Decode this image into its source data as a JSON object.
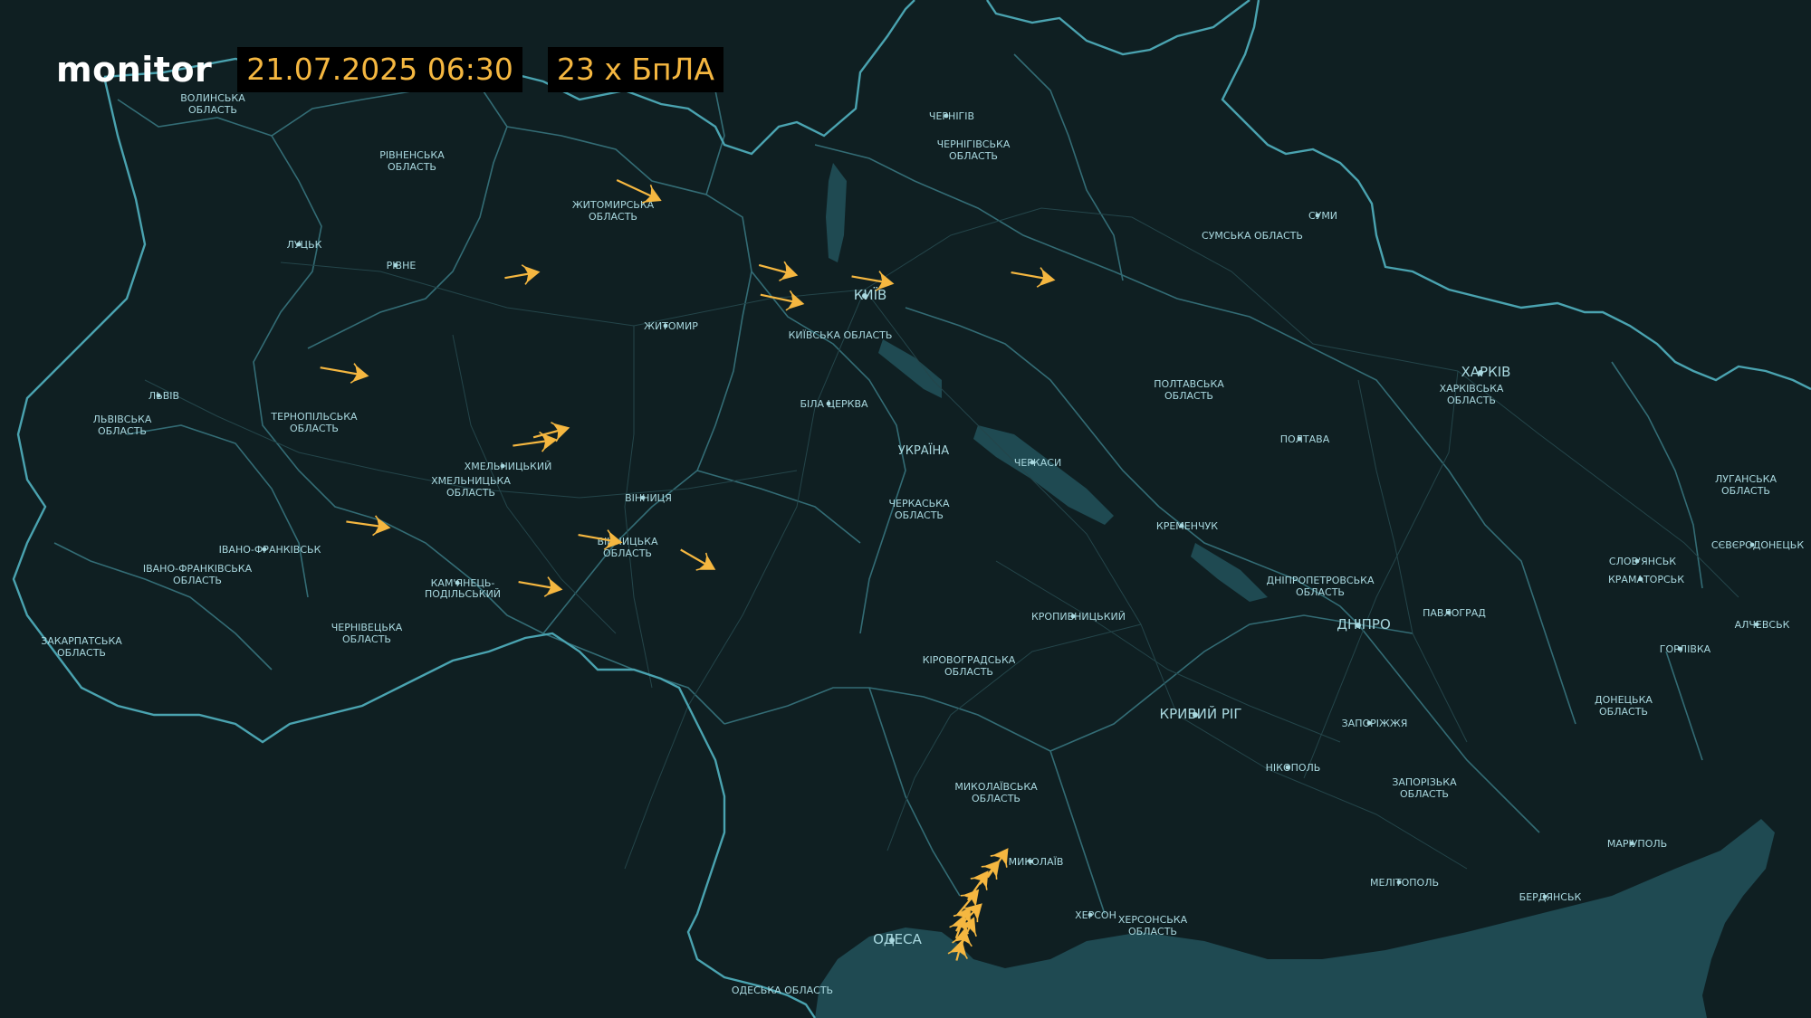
{
  "header": {
    "logo": "monitor",
    "datetime": "21.07.2025 06:30",
    "count": "23 х БпЛА"
  },
  "colors": {
    "background": "#0f1f22",
    "border": "#4aa3b0",
    "water": "#1f4a52",
    "label": "#a9d8df",
    "drone": "#f5b740"
  },
  "cities": [
    {
      "id": "kyiv",
      "name": "КИЇВ",
      "size": "lg"
    },
    {
      "id": "chernihiv",
      "name": "ЧЕРНІГІВ",
      "size": "sm"
    },
    {
      "id": "sumy",
      "name": "СУМИ",
      "size": "sm"
    },
    {
      "id": "kharkiv",
      "name": "ХАРКІВ",
      "size": "lg"
    },
    {
      "id": "zhytomyr",
      "name": "ЖИТОМИР",
      "size": "sm"
    },
    {
      "id": "lutsk",
      "name": "ЛУЦЬК",
      "size": "sm"
    },
    {
      "id": "rivne",
      "name": "РІВНЕ",
      "size": "sm"
    },
    {
      "id": "lviv",
      "name": "ЛЬВІВ",
      "size": "sm"
    },
    {
      "id": "khmelnytskyi",
      "name": "ХМЕЛЬНИЦЬКИЙ",
      "size": "sm"
    },
    {
      "id": "vinnytsia",
      "name": "ВІННИЦЯ",
      "size": "sm"
    },
    {
      "id": "bilatserkva",
      "name": "БІЛА ЦЕРКВА",
      "size": "sm"
    },
    {
      "id": "cherkasy",
      "name": "ЧЕРКАСИ",
      "size": "sm"
    },
    {
      "id": "poltava",
      "name": "ПОЛТАВА",
      "size": "sm"
    },
    {
      "id": "kremenchuk",
      "name": "КРЕМЕНЧУК",
      "size": "sm"
    },
    {
      "id": "ivanofrankivsk",
      "name": "ІВАНО-ФРАНКІВСЬК",
      "size": "sm"
    },
    {
      "id": "kamianets",
      "name": "КАМ'ЯНЕЦЬ-\nПОДІЛЬСЬКИЙ",
      "size": "sm"
    },
    {
      "id": "kropyvnytskyi",
      "name": "КРОПИВНИЦЬКИЙ",
      "size": "sm"
    },
    {
      "id": "dnipro",
      "name": "ДНІПРО",
      "size": "lg"
    },
    {
      "id": "pavlohrad",
      "name": "ПАВЛОГРАД",
      "size": "sm"
    },
    {
      "id": "kryvyirih",
      "name": "КРИВИЙ РІГ",
      "size": "lg"
    },
    {
      "id": "zaporizhzhia",
      "name": "ЗАПОРІЖЖЯ",
      "size": "sm"
    },
    {
      "id": "nikopol",
      "name": "НІКОПОЛЬ",
      "size": "sm"
    },
    {
      "id": "mykolaiv",
      "name": "МИКОЛАЇВ",
      "size": "sm"
    },
    {
      "id": "kherson",
      "name": "ХЕРСОН",
      "size": "sm"
    },
    {
      "id": "odesa",
      "name": "ОДЕСА",
      "size": "lg"
    },
    {
      "id": "melitopol",
      "name": "МЕЛІТОПОЛЬ",
      "size": "sm"
    },
    {
      "id": "berdiansk",
      "name": "БЕРДЯНСЬК",
      "size": "sm"
    },
    {
      "id": "mariupol",
      "name": "МАРІУПОЛЬ",
      "size": "sm"
    },
    {
      "id": "sloviansk",
      "name": "СЛОВ'ЯНСЬК",
      "size": "sm"
    },
    {
      "id": "kramatorsk",
      "name": "КРАМАТОРСЬК",
      "size": "sm"
    },
    {
      "id": "sievierodonetsk",
      "name": "СЄВЄРОДОНЕЦЬК",
      "size": "sm"
    },
    {
      "id": "horlivka",
      "name": "ГОРЛІВКА",
      "size": "sm"
    },
    {
      "id": "alchevsk",
      "name": "АЛЧЕВСЬК",
      "size": "sm"
    }
  ],
  "regions": [
    {
      "id": "volyn",
      "name": "ВОЛИНСЬКА\nОБЛАСТЬ"
    },
    {
      "id": "rivne_obl",
      "name": "РІВНЕНСЬКА\nОБЛАСТЬ"
    },
    {
      "id": "zhytomyr_obl",
      "name": "ЖИТОМИРСЬКА\nОБЛАСТЬ"
    },
    {
      "id": "chernihiv_obl",
      "name": "ЧЕРНІГІВСЬКА\nОБЛАСТЬ"
    },
    {
      "id": "sumy_obl",
      "name": "СУМСЬКА ОБЛАСТЬ"
    },
    {
      "id": "kyiv_obl",
      "name": "КИЇВСЬКА ОБЛАСТЬ"
    },
    {
      "id": "lviv_obl",
      "name": "ЛЬВІВСЬКА\nОБЛАСТЬ"
    },
    {
      "id": "ternopil_obl",
      "name": "ТЕРНОПІЛЬСЬКА\nОБЛАСТЬ"
    },
    {
      "id": "khmelnytskyi_obl",
      "name": "ХМЕЛЬНИЦЬКА\nОБЛАСТЬ"
    },
    {
      "id": "vinnytsia_obl",
      "name": "ВІННИЦЬКА\nОБЛАСТЬ"
    },
    {
      "id": "ukraine",
      "name": "УКРАЇНА"
    },
    {
      "id": "cherkasy_obl",
      "name": "ЧЕРКАСЬКА\nОБЛАСТЬ"
    },
    {
      "id": "poltava_obl",
      "name": "ПОЛТАВСЬКА\nОБЛАСТЬ"
    },
    {
      "id": "kharkiv_obl",
      "name": "ХАРКІВСЬКА\nОБЛАСТЬ"
    },
    {
      "id": "ivanofrankivsk_obl",
      "name": "ІВАНО-ФРАНКІВСЬКА\nОБЛАСТЬ"
    },
    {
      "id": "zakarpattia_obl",
      "name": "ЗАКАРПАТСЬКА\nОБЛАСТЬ"
    },
    {
      "id": "chernivtsi_obl",
      "name": "ЧЕРНІВЕЦЬКА\nОБЛАСТЬ"
    },
    {
      "id": "kirovohrad_obl",
      "name": "КІРОВОГРАДСЬКА\nОБЛАСТЬ"
    },
    {
      "id": "dnipro_obl",
      "name": "ДНІПРОПЕТРОВСЬКА\nОБЛАСТЬ"
    },
    {
      "id": "luhansk_obl",
      "name": "ЛУГАНСЬКА\nОБЛАСТЬ"
    },
    {
      "id": "donetsk_obl",
      "name": "ДОНЕЦЬКА\nОБЛАСТЬ"
    },
    {
      "id": "zaporizhzhia_obl",
      "name": "ЗАПОРІЗЬКА\nОБЛАСТЬ"
    },
    {
      "id": "mykolaiv_obl",
      "name": "МИКОЛАЇВСЬКА\nОБЛАСТЬ"
    },
    {
      "id": "kherson_obl",
      "name": "ХЕРСОНСЬКА\nОБЛАСТЬ"
    },
    {
      "id": "odesa_obl",
      "name": "ОДЕСЬКА ОБЛАСТЬ"
    }
  ],
  "drones": [
    {
      "id": 1
    },
    {
      "id": 2
    },
    {
      "id": 3
    },
    {
      "id": 4
    },
    {
      "id": 5
    },
    {
      "id": 6
    },
    {
      "id": 7
    },
    {
      "id": 8
    },
    {
      "id": 9
    },
    {
      "id": 10
    },
    {
      "id": 11
    },
    {
      "id": 12
    },
    {
      "id": 13
    },
    {
      "id": 14
    },
    {
      "id": 15
    },
    {
      "id": 16
    },
    {
      "id": 17
    },
    {
      "id": 18
    },
    {
      "id": 19
    },
    {
      "id": 20
    },
    {
      "id": 21
    },
    {
      "id": 22
    },
    {
      "id": 23
    }
  ]
}
